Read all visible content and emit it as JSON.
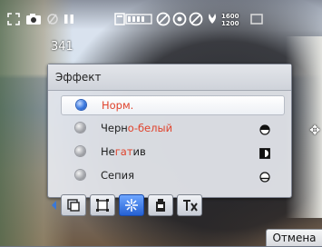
{
  "status": {
    "shots_remaining": "341",
    "resolution_top": "1600",
    "resolution_bottom": "1200"
  },
  "effect_menu": {
    "title": "Эффект",
    "options": [
      {
        "label_plain": "",
        "label_red": "Норм.",
        "label_rest": "",
        "selected": true,
        "icon": ""
      },
      {
        "label_plain": "Черн",
        "label_red": "о-белый",
        "label_rest": "",
        "selected": false,
        "icon": "half-circle-icon"
      },
      {
        "label_plain": "Не",
        "label_red": "гат",
        "label_rest": "ив",
        "selected": false,
        "icon": "negative-square-icon"
      },
      {
        "label_plain": "Сепия",
        "label_red": "",
        "label_rest": "",
        "selected": false,
        "icon": "sepia-circle-icon"
      }
    ]
  },
  "toolbar": {
    "items": [
      "frame-icon",
      "crop-icon",
      "effect-wand-icon",
      "timer-icon",
      "settings-tx-icon"
    ],
    "active_index": 2
  },
  "softkey": {
    "label": "Отмена"
  },
  "colors": {
    "accent": "#2f6fe0",
    "highlight_text": "#e0432c"
  }
}
